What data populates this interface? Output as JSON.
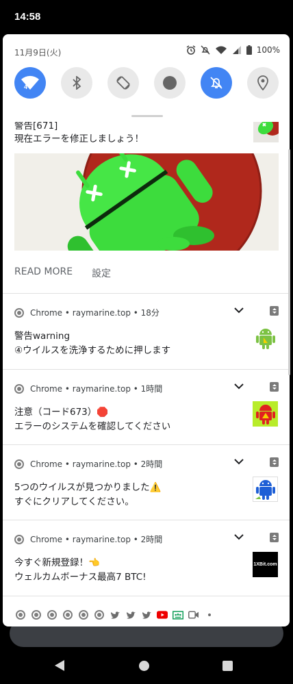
{
  "status_bar": {
    "time": "14:58"
  },
  "quick_settings": {
    "date": "11月9日(火)",
    "battery": "100%",
    "wifi_badge": "4",
    "tiles": [
      {
        "name": "wifi",
        "active": true
      },
      {
        "name": "bluetooth",
        "active": false
      },
      {
        "name": "auto-rotate",
        "active": false
      },
      {
        "name": "record",
        "active": false
      },
      {
        "name": "do-not-disturb",
        "active": true
      },
      {
        "name": "location",
        "active": false
      }
    ]
  },
  "notifications": {
    "expanded": {
      "title": "警告[671]",
      "text": "現在エラーを修正しましょう！",
      "actions": [
        "READ MORE",
        "設定"
      ]
    },
    "items": [
      {
        "header": "Chrome • raymarine.top • 18分",
        "line1": "警告warning",
        "line2": "④ウイルスを洗浄するために押します",
        "thumb": "android-icon"
      },
      {
        "header": "Chrome • raymarine.top • 1時間",
        "line1": "注意（コード673）🛑",
        "line2": "エラーのシステムを確認してください",
        "thumb": "android-warning-icon"
      },
      {
        "header": "Chrome • raymarine.top • 2時間",
        "line1": "5つのウイルスが見つかりました⚠️",
        "line2": "すぐにクリアしてください。",
        "thumb": "android-blue-icon"
      },
      {
        "header": "Chrome • raymarine.top • 2時間",
        "line1": "今すぐ新規登録！👈",
        "line2": "ウェルカムボーナス最高7 BTC!",
        "thumb": "1xbit-logo",
        "thumb_text": "1XBit.com"
      }
    ]
  },
  "icon_strip": [
    "chrome-icon",
    "chrome-icon",
    "chrome-icon",
    "chrome-icon",
    "chrome-icon",
    "chrome-icon",
    "twitter-icon",
    "twitter-icon",
    "twitter-icon",
    "youtube-icon",
    "classroom-icon",
    "meet-icon",
    "more-dot"
  ],
  "colors": {
    "accent": "#4285f4",
    "android_green": "#3ddc3d",
    "red_circle": "#b0281c"
  }
}
